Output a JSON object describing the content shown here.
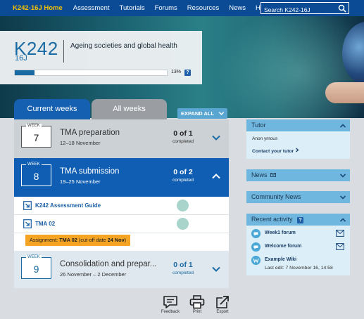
{
  "nav": {
    "home": "K242-16J Home",
    "items": [
      "Assessment",
      "Tutorials",
      "Forums",
      "Resources",
      "News"
    ],
    "help": "Help",
    "help_mark": "?",
    "search_placeholder": "Search K242-16J"
  },
  "course": {
    "code": "K242",
    "presentation": "16J",
    "title": "Ageing societies and global health",
    "progress_percent": 13,
    "progress_label": "13%",
    "info_mark": "?"
  },
  "tabs": {
    "current": "Current weeks",
    "all": "All weeks",
    "expand_all": "EXPAND ALL"
  },
  "weeks": [
    {
      "label": "WEEK",
      "number": "7",
      "title": "TMA preparation",
      "dates": "12–18 November",
      "count": "0 of 1",
      "count_label": "completed"
    },
    {
      "label": "WEEK",
      "number": "8",
      "title": "TMA submission",
      "dates": "19–25 November",
      "count": "0 of 2",
      "count_label": "completed"
    },
    {
      "label": "WEEK",
      "number": "9",
      "title": "Consolidation and prepar...",
      "dates": "26 November – 2 December",
      "count": "0 of 1",
      "count_label": "completed"
    }
  ],
  "week8_activities": [
    {
      "label": "K242 Assessment Guide"
    },
    {
      "label": "TMA 02"
    }
  ],
  "assignment": {
    "prefix": "Assignment: ",
    "name": "TMA 02",
    "cutoff_prefix": " (cut-off date ",
    "date": "24 Nov",
    "suffix": ")"
  },
  "sidebar": {
    "tutor": {
      "heading": "Tutor",
      "name": "Anon ymous",
      "contact": "Contact your tutor"
    },
    "news": {
      "heading": "News"
    },
    "community": {
      "heading": "Community News"
    },
    "recent": {
      "heading": "Recent activity",
      "info_mark": "?",
      "items": [
        {
          "name": "Week1 forum"
        },
        {
          "name": "Welcome forum"
        },
        {
          "name": "Example Wiki",
          "sub": "Last edit: 7 November 16, 14:58"
        }
      ]
    }
  },
  "footer": {
    "feedback": "Feedback",
    "print": "Print",
    "export": "Export"
  },
  "colors": {
    "nav_bg": "#0b4a94",
    "accent_blue": "#1560b0",
    "home_yellow": "#f6c100",
    "assignment_orange": "#f5a523",
    "sidebar_header": "#6fb7df"
  }
}
